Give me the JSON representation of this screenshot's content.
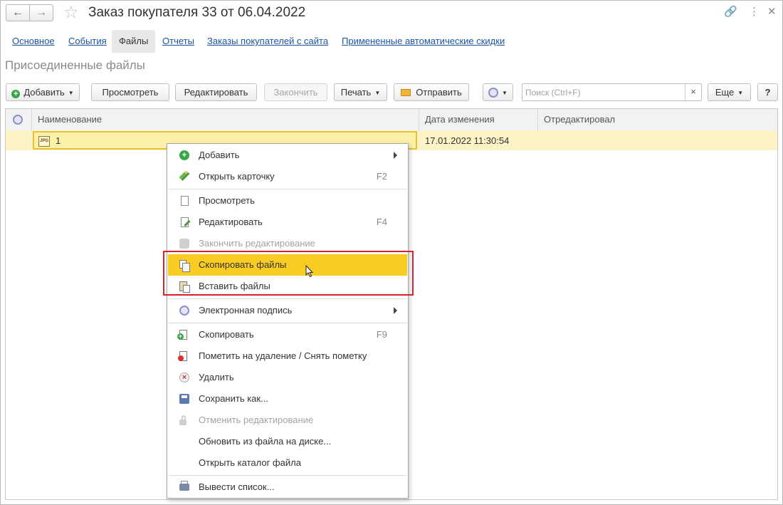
{
  "window": {
    "title": "Заказ покупателя 33 от 06.04.2022",
    "back_icon": "←",
    "forward_icon": "→",
    "star_icon": "☆",
    "link_icon": "🔗",
    "more_icon": "⋮",
    "close_icon": "✕"
  },
  "tabs": [
    {
      "label": "Основное"
    },
    {
      "label": "События"
    },
    {
      "label": "Файлы"
    },
    {
      "label": "Отчеты"
    },
    {
      "label": "Заказы покупателей с сайта"
    },
    {
      "label": "Примененные автоматические скидки"
    }
  ],
  "section_title": "Присоединенные файлы",
  "toolbar": {
    "add_label": "Добавить",
    "view_label": "Просмотреть",
    "edit_label": "Редактировать",
    "finish_label": "Закончить",
    "print_label": "Печать",
    "send_label": "Отправить",
    "search_placeholder": "Поиск (Ctrl+F)",
    "search_clear": "×",
    "more_label": "Еще",
    "help_label": "?"
  },
  "table": {
    "columns": [
      "Наименование",
      "Дата изменения",
      "Отредактировал"
    ],
    "rows": [
      {
        "icon_text": "JPG",
        "name": "1",
        "date": "17.01.2022 11:30:54",
        "editor": ""
      }
    ]
  },
  "context_menu": {
    "items": [
      {
        "label": "Добавить",
        "shortcut": "",
        "icon": "plus-icon"
      },
      {
        "label": "Открыть карточку",
        "shortcut": "F2",
        "icon": "pencil-icon"
      },
      {
        "label": "Просмотреть",
        "shortcut": "",
        "icon": "document-icon"
      },
      {
        "label": "Редактировать",
        "shortcut": "F4",
        "icon": "document-edit-icon"
      },
      {
        "label": "Закончить редактирование",
        "shortcut": "",
        "icon": "finish-edit-icon"
      },
      {
        "label": "Скопировать файлы",
        "shortcut": "",
        "icon": "copy-files-icon"
      },
      {
        "label": "Вставить файлы",
        "shortcut": "",
        "icon": "paste-files-icon"
      },
      {
        "label": "Электронная подпись",
        "shortcut": "",
        "icon": "signature-icon"
      },
      {
        "label": "Скопировать",
        "shortcut": "F9",
        "icon": "copy-icon"
      },
      {
        "label": "Пометить на удаление / Снять пометку",
        "shortcut": "",
        "icon": "mark-delete-icon"
      },
      {
        "label": "Удалить",
        "shortcut": "",
        "icon": "delete-icon"
      },
      {
        "label": "Сохранить как...",
        "shortcut": "",
        "icon": "save-icon"
      },
      {
        "label": "Отменить редактирование",
        "shortcut": "",
        "icon": "unlock-icon"
      },
      {
        "label": "Обновить из файла на диске...",
        "shortcut": "",
        "icon": ""
      },
      {
        "label": "Открыть каталог файла",
        "shortcut": "",
        "icon": ""
      },
      {
        "label": "Вывести список...",
        "shortcut": "",
        "icon": "print-list-icon"
      }
    ]
  },
  "colors": {
    "highlight": "#f9cc24",
    "selected_row": "#fcf4c6",
    "link": "#1c55a5",
    "annotation_box": "#d3262c"
  }
}
